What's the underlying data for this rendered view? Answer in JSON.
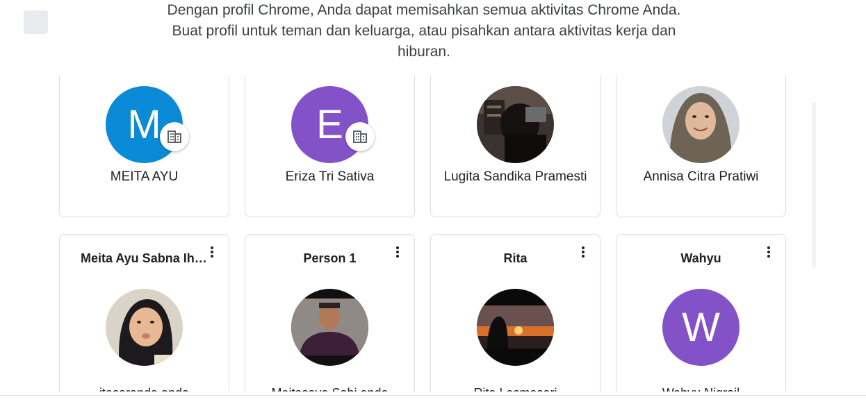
{
  "intro_text": "Dengan profil Chrome, Anda dapat memisahkan semua aktivitas Chrome Anda. Buat profil untuk teman dan keluarga, atau pisahkan antara aktivitas kerja dan hiburan.",
  "colors": {
    "avatar_blue": "#0b8ad8",
    "avatar_purple": "#8352c8",
    "card_border": "#dadce0"
  },
  "managed_profiles": [
    {
      "name": "MEITA AYU",
      "initial": "M",
      "badge_icon": "building-icon"
    },
    {
      "name": "Eriza Tri Sativa",
      "initial": "E",
      "badge_icon": "building-icon"
    },
    {
      "name": "Lugita Sandika Pramesti",
      "photo": "laptop-photo"
    },
    {
      "name": "Annisa Citra Pratiwi",
      "photo": "hijab-portrait-photo"
    }
  ],
  "profiles": [
    {
      "title": "Meita Ayu Sabna Ihsani",
      "cut_name": "itasaranda anda",
      "photo": "selfie-photo",
      "menu_icon": "more-vert-icon"
    },
    {
      "title": "Person 1",
      "cut_name": "Meitasaya Sabi anda",
      "photo": "man-portrait-photo",
      "menu_icon": "more-vert-icon"
    },
    {
      "title": "Rita",
      "cut_name": "Rita Lasmasari",
      "photo": "sunset-photo",
      "menu_icon": "more-vert-icon"
    },
    {
      "title": "Wahyu",
      "cut_name": "Wahyu Nigrail",
      "initial": "W",
      "menu_icon": "more-vert-icon"
    }
  ]
}
